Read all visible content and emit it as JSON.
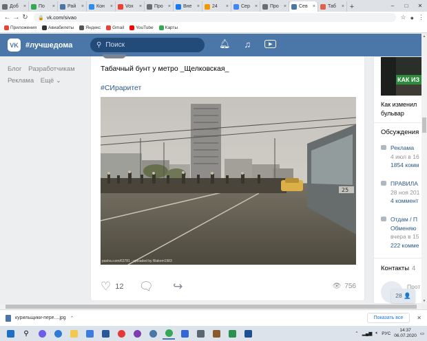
{
  "browser": {
    "tabs": [
      {
        "label": "Доб",
        "color": "#6d6d6d"
      },
      {
        "label": "По",
        "color": "#34a853"
      },
      {
        "label": "Рай",
        "color": "#4a76a8"
      },
      {
        "label": "Кон",
        "color": "#2d8cf0"
      },
      {
        "label": "Vox",
        "color": "#e94235"
      },
      {
        "label": "Про",
        "color": "#6d6d6d"
      },
      {
        "label": "Вне",
        "color": "#1877f2"
      },
      {
        "label": "24",
        "color": "#f29900"
      },
      {
        "label": "Сер",
        "color": "#4285f4"
      },
      {
        "label": "Про",
        "color": "#6d6d6d"
      },
      {
        "label": "Сев",
        "color": "#4a76a8",
        "active": true
      },
      {
        "label": "Таб",
        "color": "#e0624a"
      }
    ],
    "new_tab": "+",
    "win_minimize": "–",
    "win_maximize": "□",
    "win_close": "✕",
    "url": "vk.com/sivao",
    "bookmarks": [
      {
        "label": "Приложения",
        "color": "#ea4335"
      },
      {
        "label": "Авиабилеты",
        "color": "#333333"
      },
      {
        "label": "Яндекс",
        "color": "#555555"
      },
      {
        "label": "Gmail",
        "color": "#ea4335"
      },
      {
        "label": "YouTube",
        "color": "#ff0000"
      },
      {
        "label": "Карты",
        "color": "#34a853"
      }
    ]
  },
  "vk_header": {
    "logo": "VK",
    "title": "#лучшедома",
    "search_placeholder": "Поиск"
  },
  "left_nav": {
    "row1": [
      "Блог",
      "Разработчикам"
    ],
    "row2": [
      "Реклама",
      "Ещё ⌄"
    ]
  },
  "post": {
    "text": "Табачный бунт у метро _Щелковская_",
    "hashtag": "#СИраритет",
    "photo_caption": "pastvu.com/63781 · uploaded by Blakom1983",
    "likes": "12",
    "views": "756"
  },
  "right_col": {
    "image_text": "КАК ИЗ",
    "caption_line1": "Как изменил",
    "caption_line2": "бульвар",
    "discussions_title": "Обсуждения",
    "discussions_count": "3",
    "discussions": [
      {
        "title": "Реклама",
        "date": "4 июл в 16",
        "comments": "1854 комм"
      },
      {
        "title": "ПРАВИЛА",
        "date": "28 ноя 201",
        "comments": "4 коммент"
      },
      {
        "title": "Отдам / П",
        "extra": "Обменяю",
        "date": "вчера в 15",
        "comments": "222 комме"
      }
    ],
    "contacts_title": "Контакты",
    "contacts_count": "4",
    "contact_line1": "Прот",
    "contact_line2": "49"
  },
  "online_badge": "28 👤",
  "download_bar": {
    "filename": "курильщики-пере....jpg",
    "show_all": "Показать все",
    "close": "✕"
  },
  "taskbar": {
    "lang": "РУС",
    "time": "14:37",
    "date": "06.07.2020"
  }
}
